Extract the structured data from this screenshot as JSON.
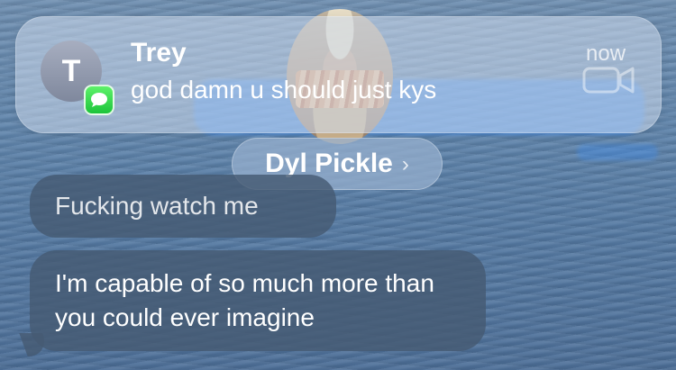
{
  "notification": {
    "avatar_initial": "T",
    "app_icon": "messages-icon",
    "sender": "Trey",
    "preview": "god damn u should just kys",
    "time": "now"
  },
  "conversation": {
    "contact_name": "Dyl Pickle",
    "contact_chevron": "›",
    "video_call_icon": "video-camera-icon",
    "messages": [
      {
        "direction": "received",
        "text": "Fucking watch me"
      },
      {
        "direction": "received",
        "text": "I'm capable of so much more than you could ever imagine"
      }
    ]
  },
  "colors": {
    "background_water": "#5f84ab",
    "banner_glass": "#cddaec",
    "received_bubble": "#465a73",
    "imessage_blue": "#3d8df2",
    "messages_green": "#1cc43b"
  }
}
